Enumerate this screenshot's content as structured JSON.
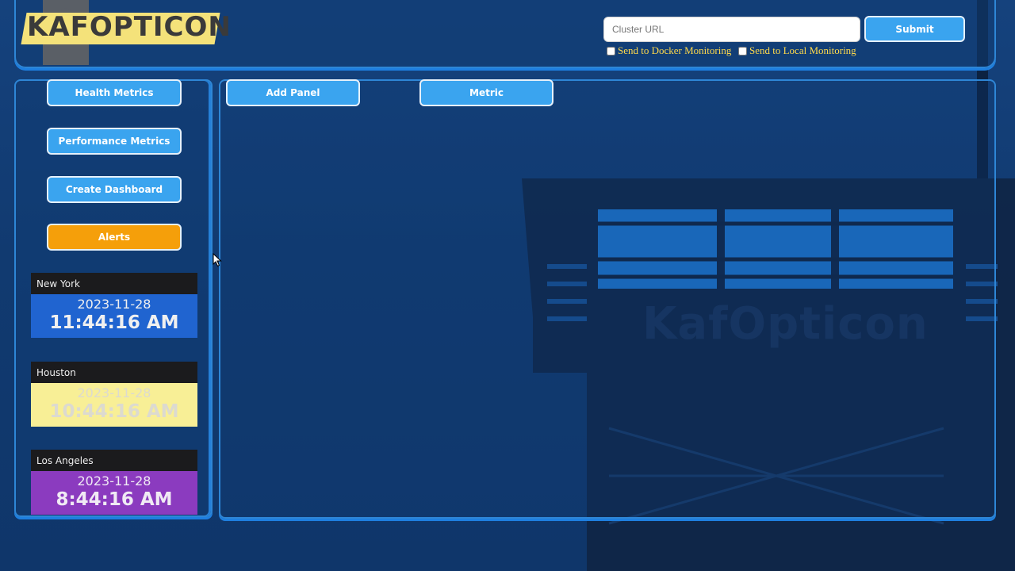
{
  "logo": {
    "text": "KAFOPTICON"
  },
  "watermark": "KafOpticon",
  "header": {
    "url_placeholder": "Cluster URL",
    "submit_label": "Submit",
    "docker_label": "Send to Docker Monitoring",
    "local_label": "Send to Local Monitoring",
    "docker_checked": false,
    "local_checked": false
  },
  "sidebar": {
    "health_label": "Health Metrics",
    "performance_label": "Performance Metrics",
    "dashboard_label": "Create Dashboard",
    "alerts_label": "Alerts"
  },
  "toolbar": {
    "add_panel_label": "Add Panel",
    "metric_label": "Metric"
  },
  "clocks": [
    {
      "city": "New York",
      "date": "2023-11-28",
      "time": "11:44:16 AM",
      "bg": "#2064d0",
      "fg": "#f0f0f0"
    },
    {
      "city": "Houston",
      "date": "2023-11-28",
      "time": "10:44:16 AM",
      "bg": "#f8ef96",
      "fg": "#dcdad0"
    },
    {
      "city": "Los Angeles",
      "date": "2023-11-28",
      "time": "8:44:16 AM",
      "bg": "#8b3bbf",
      "fg": "#f0eaf4"
    }
  ],
  "colors": {
    "accent": "#3aa4ef",
    "alerts": "#f59f0a",
    "background": "#123c73",
    "check_label": "#ffd94a"
  }
}
